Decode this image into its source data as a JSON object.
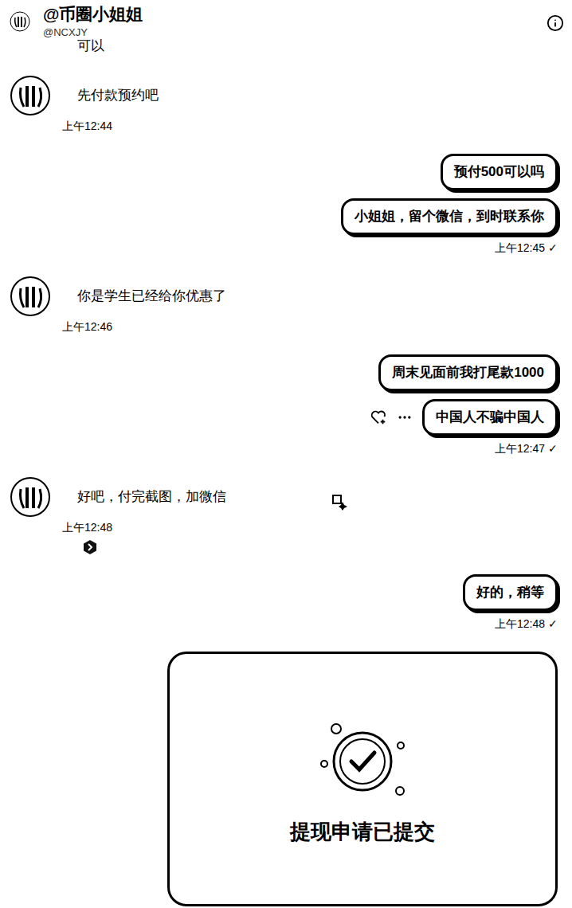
{
  "header": {
    "title": "@币圈小姐姐",
    "handle": "@NCXJY"
  },
  "conversation": [
    {
      "side": "left",
      "avatar": false,
      "bubbles": [
        {
          "text": "可以",
          "show_actions": false
        }
      ],
      "show_extra_icons": false
    },
    {
      "side": "left",
      "avatar": true,
      "bubbles": [
        {
          "text": "先付款预约吧",
          "show_actions": false
        }
      ],
      "time": "上午12:44",
      "show_extra_icons": false
    },
    {
      "side": "right",
      "avatar": false,
      "bubbles": [
        {
          "text": "预付500可以吗",
          "show_actions": false
        },
        {
          "text": "小姐姐，留个微信，到时联系你",
          "show_actions": false
        }
      ],
      "time": "上午12:45",
      "receipt": "✓",
      "show_extra_icons": false
    },
    {
      "side": "left",
      "avatar": true,
      "bubbles": [
        {
          "text": "你是学生已经给你优惠了",
          "show_actions": false
        }
      ],
      "time": "上午12:46",
      "show_extra_icons": false
    },
    {
      "side": "right",
      "avatar": false,
      "bubbles": [
        {
          "text": "周末见面前我打尾款1000",
          "show_actions": false
        },
        {
          "text": "中国人不骗中国人",
          "show_actions": true
        }
      ],
      "time": "上午12:47",
      "receipt": "✓",
      "show_extra_icons": false
    },
    {
      "side": "left",
      "avatar": true,
      "bubbles": [
        {
          "text": "好吧，付完截图，加微信",
          "show_actions": false
        }
      ],
      "time": "上午12:48",
      "show_extra_icons": true
    },
    {
      "side": "right",
      "avatar": false,
      "bubbles": [
        {
          "text": "好的，稍等",
          "show_actions": false
        }
      ],
      "time": "上午12:48",
      "receipt": "✓",
      "show_extra_icons": false
    }
  ],
  "image_card": {
    "text": "提现申请已提交"
  }
}
